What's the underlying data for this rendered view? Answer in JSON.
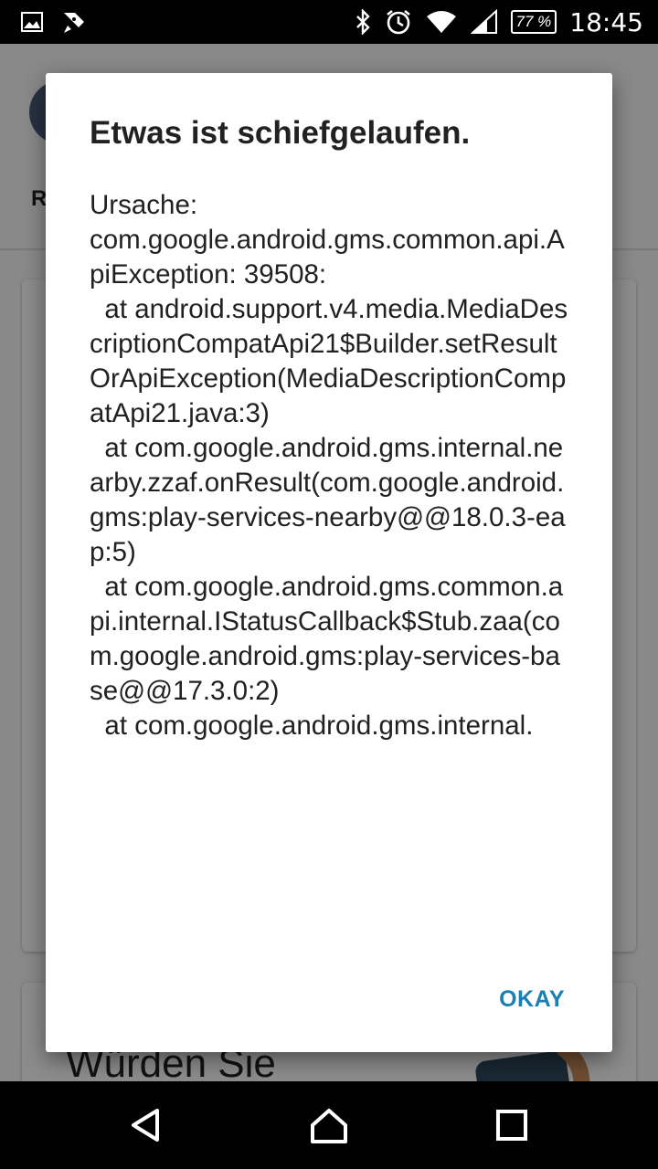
{
  "status_bar": {
    "time": "18:45",
    "battery": "77 %",
    "left_icons": [
      "image-icon",
      "rocket-icon"
    ],
    "right_icons": [
      "bluetooth-icon",
      "alarm-icon",
      "wifi-icon",
      "signal-icon"
    ]
  },
  "background": {
    "tab_label": "R",
    "card_text": "Würden Sie"
  },
  "dialog": {
    "title": "Etwas ist schiefgelaufen.",
    "message": "Ursache:\ncom.google.android.gms.common.api.ApiException: 39508:\n  at android.support.v4.media.MediaDescriptionCompatApi21$Builder.setResultOrApiException(MediaDescriptionCompatApi21.java:3)\n  at com.google.android.gms.internal.nearby.zzaf.onResult(com.google.android.gms:play-services-nearby@@18.0.3-eap:5)\n  at com.google.android.gms.common.api.internal.IStatusCallback$Stub.zaa(com.google.android.gms:play-services-base@@17.3.0:2)\n  at com.google.android.gms.internal.",
    "ok_label": "OKAY",
    "accent": "#1a7fb5"
  },
  "nav_bar": {
    "buttons": [
      "back-icon",
      "home-icon",
      "recents-icon"
    ]
  }
}
